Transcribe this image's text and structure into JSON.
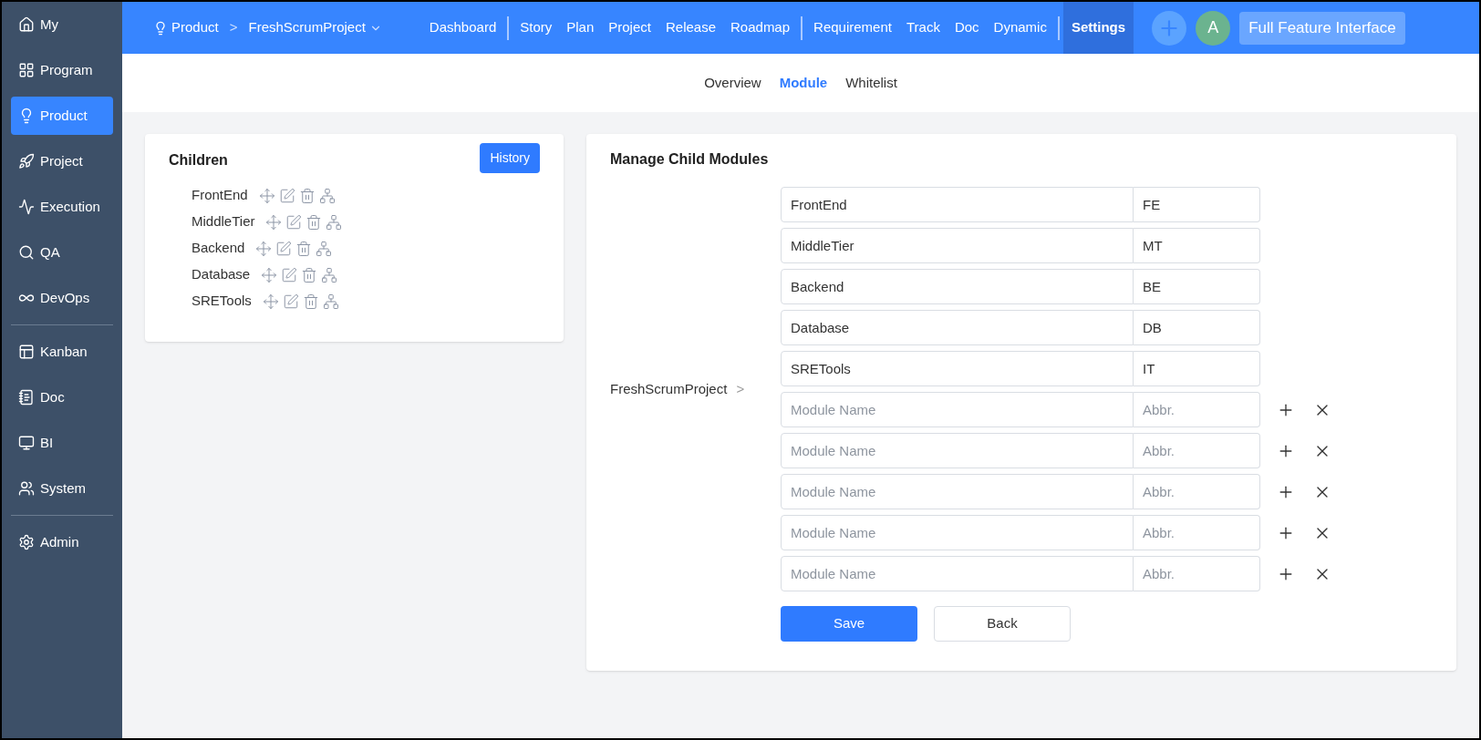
{
  "sidebar": {
    "groups": [
      [
        {
          "label": "My",
          "selected": false
        },
        {
          "label": "Program",
          "selected": false
        },
        {
          "label": "Product",
          "selected": true
        },
        {
          "label": "Project",
          "selected": false
        },
        {
          "label": "Execution",
          "selected": false
        },
        {
          "label": "QA",
          "selected": false
        },
        {
          "label": "DevOps",
          "selected": false
        }
      ],
      [
        {
          "label": "Kanban",
          "selected": false
        },
        {
          "label": "Doc",
          "selected": false
        },
        {
          "label": "BI",
          "selected": false
        },
        {
          "label": "System",
          "selected": false
        }
      ],
      [
        {
          "label": "Admin",
          "selected": false
        }
      ]
    ]
  },
  "topbar": {
    "breadcrumb": {
      "root": "Product",
      "separator": ">",
      "current": "FreshScrumProject"
    },
    "nav_groups": [
      [
        {
          "label": "Dashboard",
          "selected": false
        }
      ],
      [
        {
          "label": "Story",
          "selected": false
        },
        {
          "label": "Plan",
          "selected": false
        },
        {
          "label": "Project",
          "selected": false
        },
        {
          "label": "Release",
          "selected": false
        },
        {
          "label": "Roadmap",
          "selected": false
        }
      ],
      [
        {
          "label": "Requirement",
          "selected": false
        },
        {
          "label": "Track",
          "selected": false
        },
        {
          "label": "Doc",
          "selected": false
        },
        {
          "label": "Dynamic",
          "selected": false
        }
      ],
      [
        {
          "label": "Settings",
          "selected": true
        }
      ]
    ],
    "avatar": "A",
    "feature_button": "Full Feature Interface"
  },
  "subnav": [
    {
      "label": "Overview",
      "selected": false
    },
    {
      "label": "Module",
      "selected": true
    },
    {
      "label": "Whitelist",
      "selected": false
    }
  ],
  "children_panel": {
    "title": "Children",
    "history_button": "History",
    "items": [
      "FrontEnd",
      "MiddleTier",
      "Backend",
      "Database",
      "SRETools"
    ]
  },
  "manage_panel": {
    "title": "Manage Child Modules",
    "parent": "FreshScrumProject",
    "parent_chevron": ">",
    "rows": [
      {
        "kind": "existing",
        "name": "FrontEnd",
        "abbr": "FE"
      },
      {
        "kind": "existing",
        "name": "MiddleTier",
        "abbr": "MT"
      },
      {
        "kind": "existing",
        "name": "Backend",
        "abbr": "BE"
      },
      {
        "kind": "existing",
        "name": "Database",
        "abbr": "DB"
      },
      {
        "kind": "existing",
        "name": "SRETools",
        "abbr": "IT"
      },
      {
        "kind": "new",
        "name_placeholder": "Module Name",
        "abbr_placeholder": "Abbr."
      },
      {
        "kind": "new",
        "name_placeholder": "Module Name",
        "abbr_placeholder": "Abbr."
      },
      {
        "kind": "new",
        "name_placeholder": "Module Name",
        "abbr_placeholder": "Abbr."
      },
      {
        "kind": "new",
        "name_placeholder": "Module Name",
        "abbr_placeholder": "Abbr."
      },
      {
        "kind": "new",
        "name_placeholder": "Module Name",
        "abbr_placeholder": "Abbr."
      }
    ],
    "save_button": "Save",
    "back_button": "Back"
  }
}
